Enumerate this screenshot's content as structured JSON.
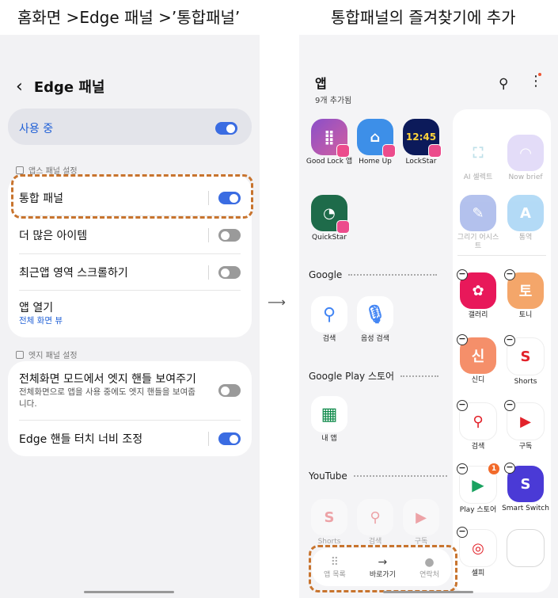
{
  "captions": {
    "left": "홈화면 >Edge 패널 >’통합패널’",
    "right": "통합패널의 즐겨찾기에 추가"
  },
  "left_screen": {
    "title": "Edge 패널",
    "master": {
      "label": "사용 중",
      "on": true
    },
    "section1": "앱스 패널 설정",
    "rows1": [
      {
        "label": "통합 패널",
        "on": true
      },
      {
        "label": "더 많은 아이템",
        "on": false
      },
      {
        "label": "최근앱 영역 스크롤하기",
        "on": false
      },
      {
        "label": "앱 열기",
        "sub": "전체 화면 뷰"
      }
    ],
    "section2": "엣지 패널 설정",
    "rows2": [
      {
        "label": "전체화면 모드에서 엣지 핸들 보여주기",
        "sub": "전체화면으로 앱을 사용 중에도 엣지 핸들을 보여줍니다.",
        "on": false
      },
      {
        "label": "Edge 핸들 터치 너비 조정",
        "on": true
      }
    ]
  },
  "right_screen": {
    "title": "앱",
    "subtitle": "9개 추가됨",
    "apps_top": [
      {
        "label": "Good Lock 앱"
      },
      {
        "label": "Home Up"
      },
      {
        "label": "LockStar"
      },
      {
        "label": "QuickStar"
      }
    ],
    "google_title": "Google",
    "google_apps": [
      {
        "label": "검색"
      },
      {
        "label": "음성 검색"
      }
    ],
    "play_title": "Google Play 스토어",
    "play_apps": [
      {
        "label": "내 앱"
      }
    ],
    "youtube_title": "YouTube",
    "youtube_apps": [
      {
        "label": "Shorts"
      },
      {
        "label": "검색"
      },
      {
        "label": "구독"
      }
    ],
    "favorites": [
      {
        "label": "AI 셀렉트"
      },
      {
        "label": "Now brief"
      },
      {
        "label": "그리기 어시스트"
      },
      {
        "label": "통역"
      },
      {
        "label": "갤러리"
      },
      {
        "label": "토니"
      },
      {
        "label": "신디"
      },
      {
        "label": "Shorts"
      },
      {
        "label": "검색"
      },
      {
        "label": "구독"
      },
      {
        "label": "Play 스토어"
      },
      {
        "label": "Smart Switch"
      },
      {
        "label": "셀피"
      }
    ],
    "icon_text": {
      "lockstar": "12:45",
      "tony": "토",
      "sindy": "신"
    },
    "play_badge": "1",
    "bottom_bar": [
      {
        "label": "앱 목록",
        "icon": "grid-icon"
      },
      {
        "label": "바로가기",
        "icon": "arrow-right-icon"
      },
      {
        "label": "연락처",
        "icon": "person-icon"
      }
    ]
  },
  "colors": {
    "accent": "#3a6ce2",
    "highlight": "#c8742e",
    "link": "#1f5fd6"
  }
}
